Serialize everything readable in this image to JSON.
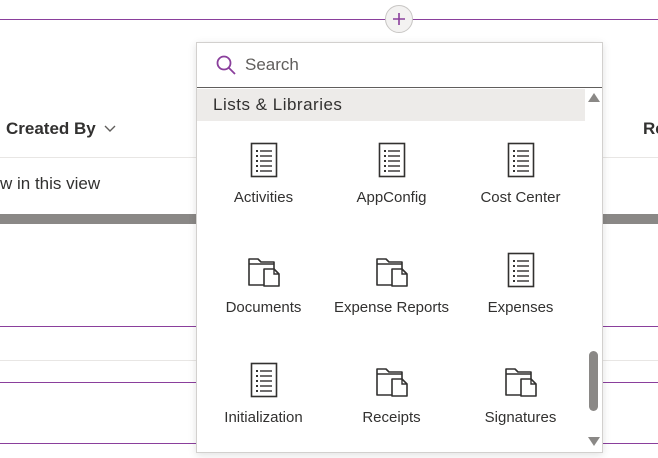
{
  "list": {
    "column_created_by": "Created By",
    "column_right_partial": "Re",
    "empty_view_text": "w in this view"
  },
  "picker": {
    "search_placeholder": "Search",
    "group_title": "Lists & Libraries",
    "items": [
      {
        "label": "Activities",
        "icon": "list-icon"
      },
      {
        "label": "AppConfig",
        "icon": "list-icon"
      },
      {
        "label": "Cost Center",
        "icon": "list-icon"
      },
      {
        "label": "Documents",
        "icon": "library-icon"
      },
      {
        "label": "Expense Reports",
        "icon": "library-icon"
      },
      {
        "label": "Expenses",
        "icon": "list-icon"
      },
      {
        "label": "Initialization",
        "icon": "list-icon"
      },
      {
        "label": "Receipts",
        "icon": "library-icon"
      },
      {
        "label": "Signatures",
        "icon": "library-icon"
      }
    ]
  },
  "colors": {
    "accent": "#8a3f9c",
    "text": "#323130",
    "icon": "#323130"
  }
}
